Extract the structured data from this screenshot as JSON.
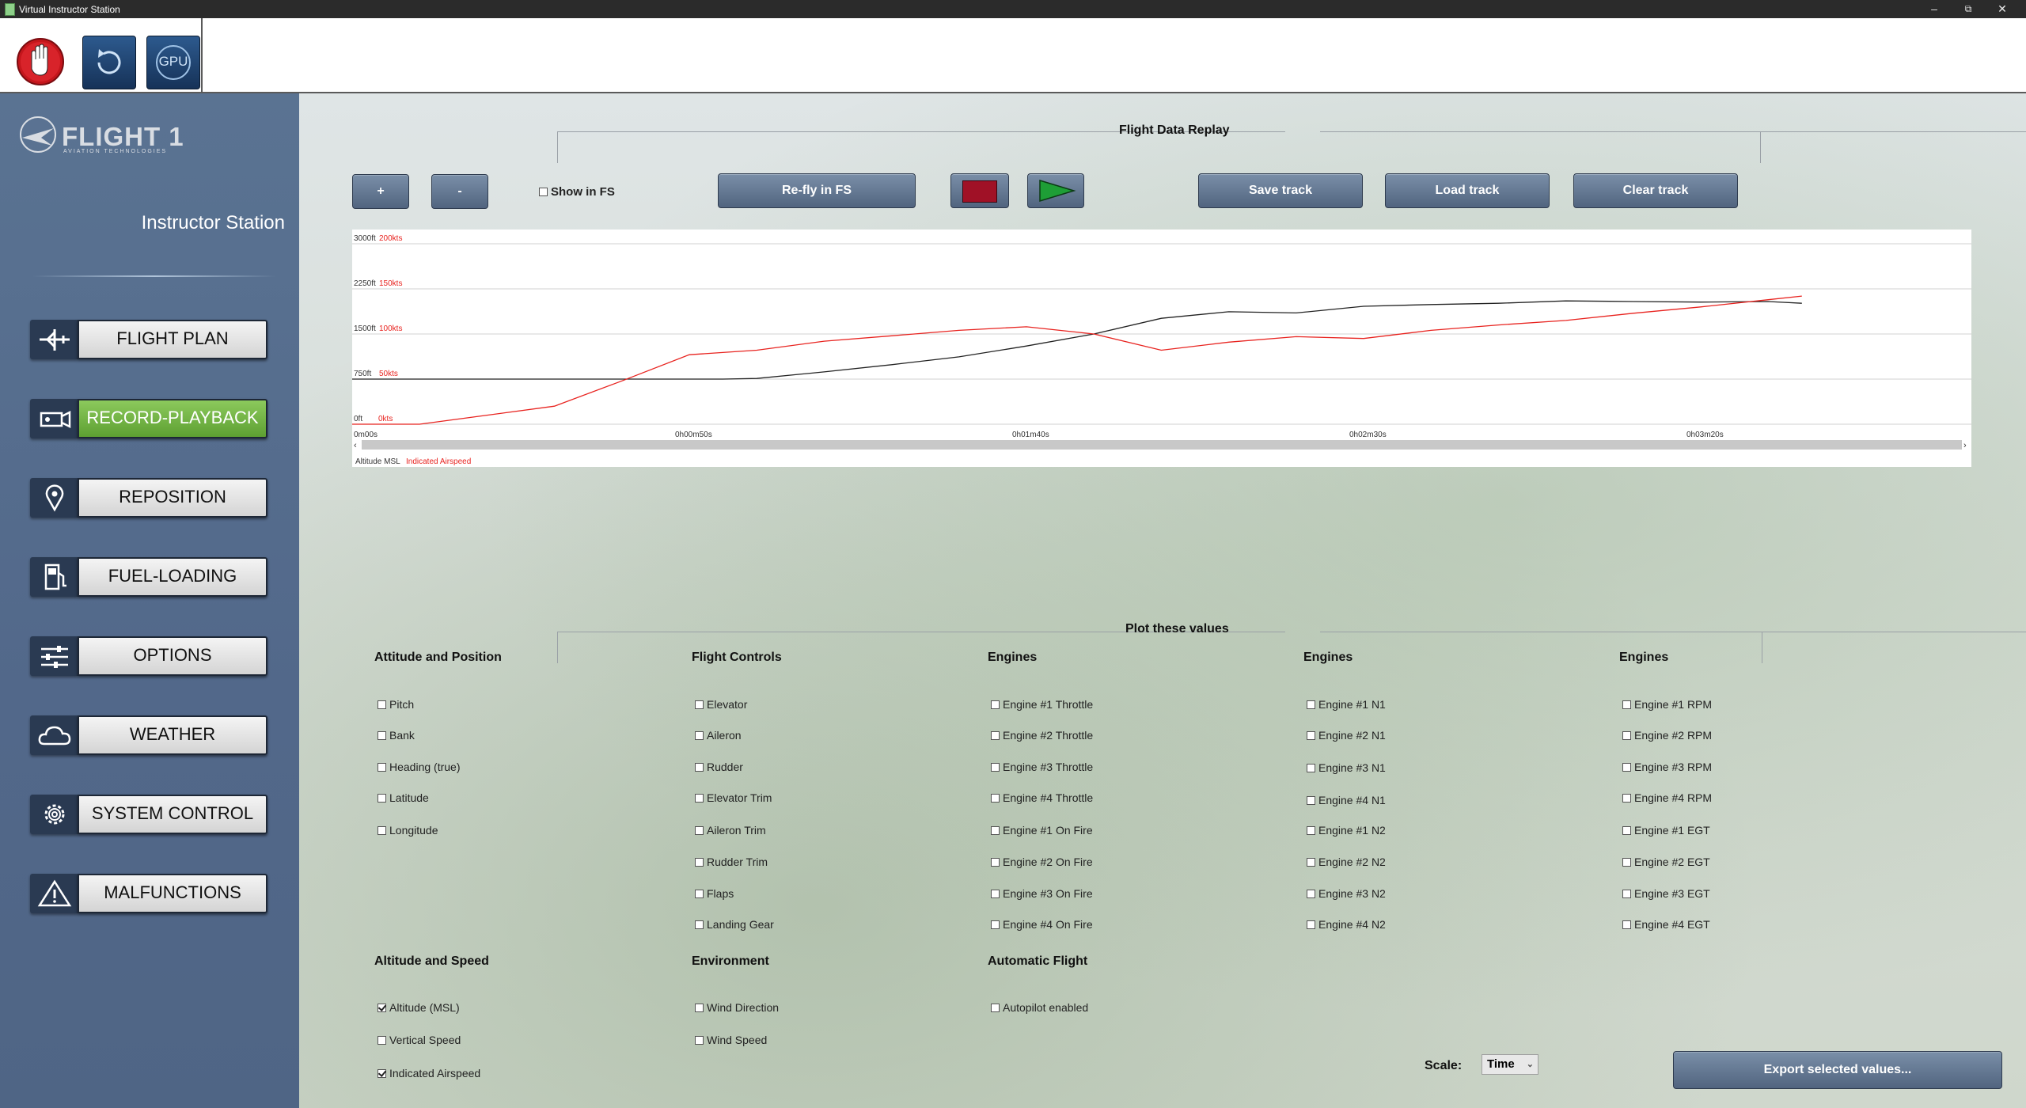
{
  "window": {
    "title": "Virtual Instructor Station"
  },
  "sidebar": {
    "brand": "FLIGHT 1",
    "brand_sub": "AVIATION TECHNOLOGIES",
    "station_title": "Instructor Station",
    "items": [
      {
        "label": "FLIGHT PLAN",
        "icon": "airplane-icon",
        "active": false
      },
      {
        "label": "RECORD-PLAYBACK",
        "icon": "video-camera-icon",
        "active": true
      },
      {
        "label": "REPOSITION",
        "icon": "map-pin-icon",
        "active": false
      },
      {
        "label": "FUEL-LOADING",
        "icon": "fuel-pump-icon",
        "active": false
      },
      {
        "label": "OPTIONS",
        "icon": "sliders-icon",
        "active": false
      },
      {
        "label": "WEATHER",
        "icon": "cloud-icon",
        "active": false
      },
      {
        "label": "SYSTEM CONTROL",
        "icon": "gear-icon",
        "active": false
      },
      {
        "label": "MALFUNCTIONS",
        "icon": "warning-icon",
        "active": false
      }
    ]
  },
  "toolbar": {
    "stop_icon": "hand-stop-icon",
    "refresh_icon": "refresh-icon",
    "gpu_label": "GPU"
  },
  "replay": {
    "title": "Flight Data Replay",
    "zoom_in": "+",
    "zoom_out": "-",
    "show_in_fs": "Show in FS",
    "refly": "Re-fly in FS",
    "save": "Save track",
    "load": "Load track",
    "clear": "Clear track"
  },
  "chart_data": {
    "type": "line",
    "x_ticks": [
      "0m00s",
      "0h00m50s",
      "0h01m40s",
      "0h02m30s",
      "0h03m20s"
    ],
    "y_ticks_altitude": [
      "0ft",
      "750ft",
      "1500ft",
      "2250ft",
      "3000ft"
    ],
    "y_ticks_airspeed": [
      "0kts",
      "50kts",
      "100kts",
      "150kts",
      "200kts"
    ],
    "x_seconds_range": [
      0,
      240
    ],
    "series": [
      {
        "name": "Altitude MSL",
        "color": "#222222",
        "unit": "ft",
        "x": [
          0,
          20,
          40,
          55,
          60,
          70,
          80,
          90,
          100,
          110,
          120,
          130,
          140,
          150,
          160,
          170,
          180,
          190,
          200,
          210,
          215
        ],
        "y": [
          750,
          750,
          750,
          750,
          760,
          870,
          990,
          1120,
          1300,
          1500,
          1760,
          1870,
          1850,
          1960,
          1990,
          2010,
          2050,
          2040,
          2030,
          2040,
          2010
        ]
      },
      {
        "name": "Indicated Airspeed",
        "color": "#e8231f",
        "unit": "kts",
        "x": [
          0,
          10,
          20,
          30,
          40,
          50,
          60,
          70,
          80,
          90,
          100,
          110,
          120,
          130,
          140,
          150,
          160,
          170,
          180,
          190,
          200,
          210,
          215
        ],
        "y": [
          0,
          0,
          10,
          20,
          48,
          77,
          82,
          92,
          98,
          104,
          108,
          100,
          82,
          91,
          97,
          95,
          104,
          110,
          115,
          123,
          130,
          138,
          142
        ]
      }
    ],
    "ylim_altitude": [
      0,
      3000
    ],
    "ylim_airspeed": [
      0,
      200
    ],
    "legend": "bottom-left",
    "grid": true
  },
  "plot": {
    "title": "Plot these values",
    "columns": [
      {
        "head": "Attitude and Position",
        "items": [
          {
            "label": "Pitch",
            "checked": false
          },
          {
            "label": "Bank",
            "checked": false
          },
          {
            "label": "Heading (true)",
            "checked": false
          },
          {
            "label": "Latitude",
            "checked": false
          },
          {
            "label": "Longitude",
            "checked": false
          }
        ]
      },
      {
        "head": "Flight Controls",
        "items": [
          {
            "label": "Elevator",
            "checked": false
          },
          {
            "label": "Aileron",
            "checked": false
          },
          {
            "label": "Rudder",
            "checked": false
          },
          {
            "label": "Elevator Trim",
            "checked": false
          },
          {
            "label": "Aileron Trim",
            "checked": false
          },
          {
            "label": "Rudder Trim",
            "checked": false
          },
          {
            "label": "Flaps",
            "checked": false
          },
          {
            "label": "Landing Gear",
            "checked": false
          }
        ]
      },
      {
        "head": "Engines",
        "items": [
          {
            "label": "Engine #1 Throttle",
            "checked": false
          },
          {
            "label": "Engine #2 Throttle",
            "checked": false
          },
          {
            "label": "Engine #3 Throttle",
            "checked": false
          },
          {
            "label": "Engine #4 Throttle",
            "checked": false
          },
          {
            "label": "Engine #1 On Fire",
            "checked": false
          },
          {
            "label": "Engine #2 On Fire",
            "checked": false
          },
          {
            "label": "Engine #3 On Fire",
            "checked": false
          },
          {
            "label": "Engine #4 On Fire",
            "checked": false
          }
        ]
      },
      {
        "head": "Engines",
        "items": [
          {
            "label": "Engine #1 N1",
            "checked": false
          },
          {
            "label": "Engine #2 N1",
            "checked": false
          },
          {
            "label": "Engine #3 N1",
            "checked": false
          },
          {
            "label": "Engine #4 N1",
            "checked": false
          },
          {
            "label": "Engine #1 N2",
            "checked": false
          },
          {
            "label": "Engine #2 N2",
            "checked": false
          },
          {
            "label": "Engine #3 N2",
            "checked": false
          },
          {
            "label": "Engine #4 N2",
            "checked": false
          }
        ]
      },
      {
        "head": "Engines",
        "items": [
          {
            "label": "Engine #1 RPM",
            "checked": false
          },
          {
            "label": "Engine #2 RPM",
            "checked": false
          },
          {
            "label": "Engine #3 RPM",
            "checked": false
          },
          {
            "label": "Engine #4 RPM",
            "checked": false
          },
          {
            "label": "Engine #1 EGT",
            "checked": false
          },
          {
            "label": "Engine #2 EGT",
            "checked": false
          },
          {
            "label": "Engine #3 EGT",
            "checked": false
          },
          {
            "label": "Engine #4 EGT",
            "checked": false
          }
        ]
      }
    ],
    "bottom_columns": [
      {
        "head": "Altitude and Speed",
        "items": [
          {
            "label": "Altitude (MSL)",
            "checked": true
          },
          {
            "label": "Vertical Speed",
            "checked": false
          },
          {
            "label": "Indicated Airspeed",
            "checked": true
          }
        ]
      },
      {
        "head": "Environment",
        "items": [
          {
            "label": "Wind Direction",
            "checked": false
          },
          {
            "label": "Wind Speed",
            "checked": false
          }
        ]
      },
      {
        "head": "Automatic Flight",
        "items": [
          {
            "label": "Autopilot enabled",
            "checked": false
          }
        ]
      }
    ],
    "scale_label": "Scale:",
    "scale_value": "Time",
    "export": "Export selected values..."
  }
}
